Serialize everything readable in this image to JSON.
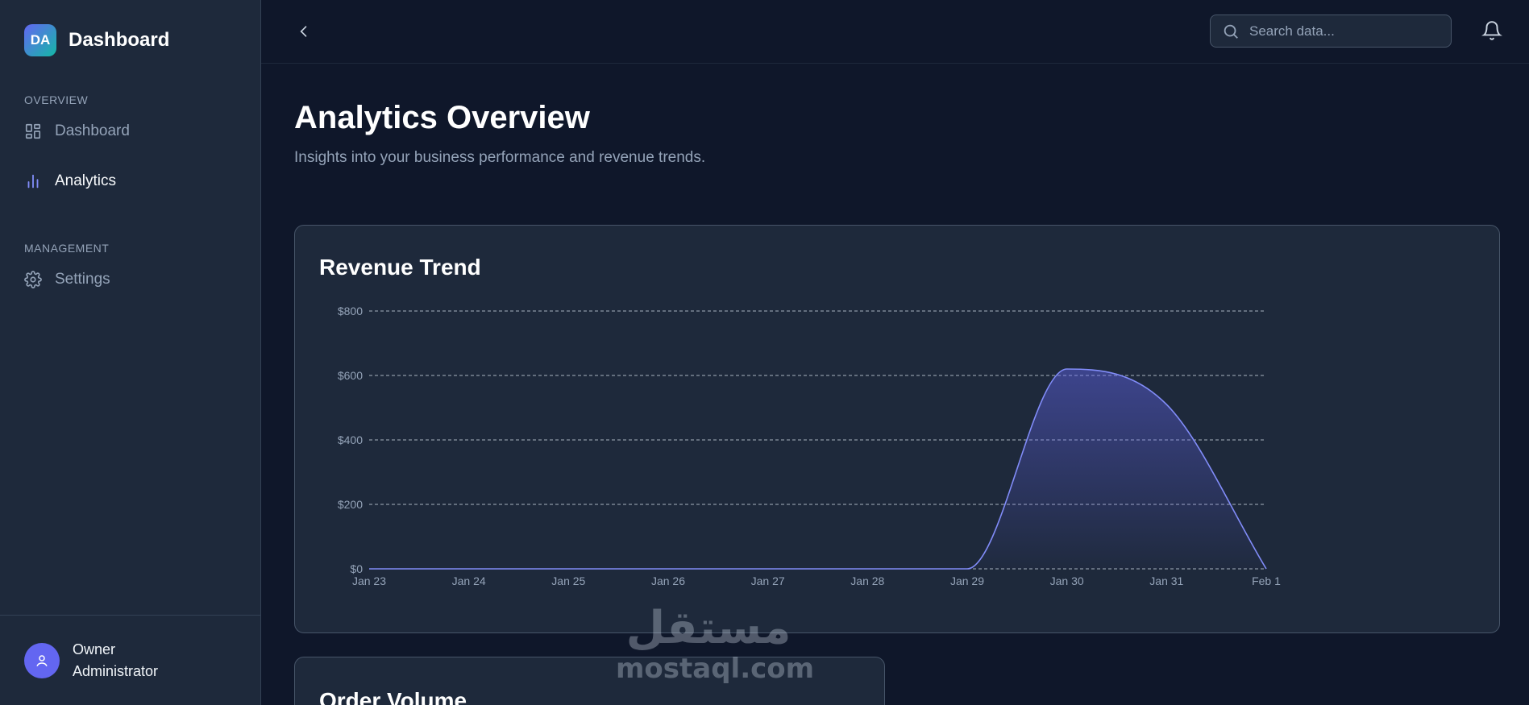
{
  "brand": {
    "logo": "DA",
    "title": "Dashboard"
  },
  "sidebar": {
    "sections": [
      {
        "label": "OVERVIEW",
        "items": [
          {
            "label": "Dashboard",
            "icon": "grid-icon",
            "active": false
          },
          {
            "label": "Analytics",
            "icon": "bar-chart-icon",
            "active": true
          }
        ]
      },
      {
        "label": "MANAGEMENT",
        "items": [
          {
            "label": "Settings",
            "icon": "gear-icon",
            "active": false
          }
        ]
      }
    ],
    "user": {
      "name_line1": "Owner",
      "name_line2": "Administrator"
    }
  },
  "topbar": {
    "search_placeholder": "Search data..."
  },
  "page": {
    "title": "Analytics Overview",
    "subtitle": "Insights into your business performance and revenue trends."
  },
  "revenue_card": {
    "title": "Revenue Trend"
  },
  "orders_card": {
    "title": "Order Volume"
  },
  "watermark": {
    "arabic": "مستقل",
    "latin": "mostaql.com"
  },
  "colors": {
    "accent": "#6366f1",
    "line": "#818cf8",
    "bg": "#0f172a",
    "panel": "#1e293b"
  },
  "chart_data": {
    "type": "area",
    "title": "Revenue Trend",
    "x": [
      "Jan 23",
      "Jan 24",
      "Jan 25",
      "Jan 26",
      "Jan 27",
      "Jan 28",
      "Jan 29",
      "Jan 30",
      "Jan 31",
      "Feb 1"
    ],
    "series": [
      {
        "values": [
          0,
          0,
          0,
          0,
          0,
          0,
          0,
          620,
          510,
          0
        ]
      }
    ],
    "y_ticks": [
      "$0",
      "$200",
      "$400",
      "$600",
      "$800"
    ],
    "ylim": [
      0,
      800
    ],
    "grid": true,
    "curve": "smooth"
  }
}
